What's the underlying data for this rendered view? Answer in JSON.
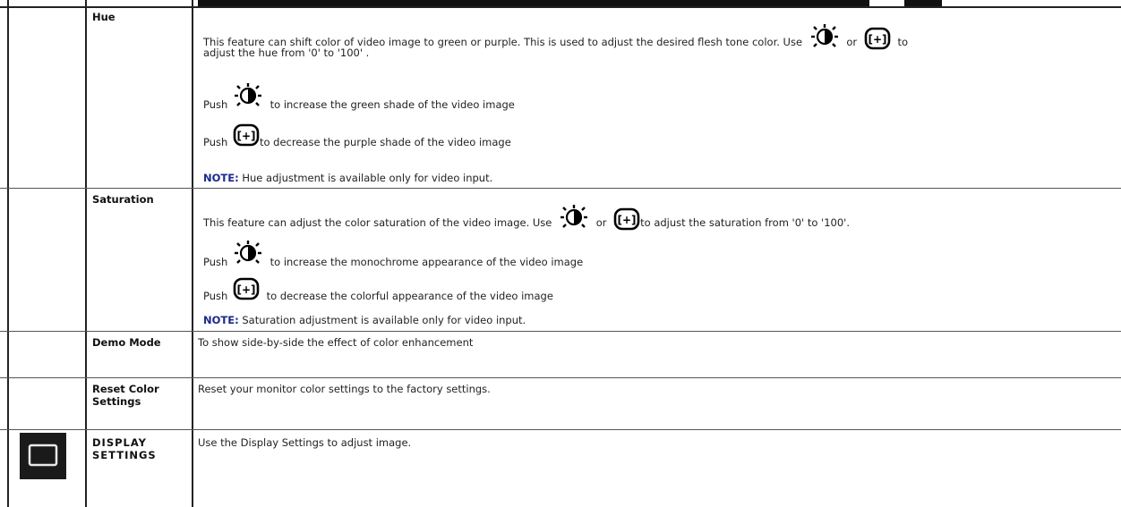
{
  "rows": {
    "hue": {
      "label": "Hue",
      "desc_a": "This feature can shift color of video image to green or purple. This is used to adjust the desired flesh tone color. Use",
      "desc_or": "or",
      "desc_to": "to",
      "desc_b": "adjust the hue from '0' to '100' .",
      "push": "Push",
      "increase": "to increase the green shade of the video image",
      "decrease": "to decrease the purple shade of the video image",
      "note_label": "NOTE:",
      "note_text": "Hue adjustment is available only for video input."
    },
    "saturation": {
      "label": "Saturation",
      "desc_a": "This feature can adjust the color saturation of the video image. Use",
      "desc_or": "or",
      "desc_b": "to adjust the saturation from '0' to '100'.",
      "push": "Push",
      "increase": "to increase the monochrome appearance of the video image",
      "decrease": "to decrease the colorful appearance of the video image",
      "note_label": "NOTE:",
      "note_text": "Saturation adjustment is available only for video input."
    },
    "demo": {
      "label": "Demo Mode",
      "text": "To show side-by-side the effect of color enhancement"
    },
    "reset": {
      "label_line1": "Reset Color",
      "label_line2": "Settings",
      "text": "Reset your monitor color settings to the factory settings."
    },
    "display": {
      "label_line1": "DISPLAY",
      "label_line2": "SETTINGS",
      "text": "Use the Display Settings to adjust image.",
      "icon": "display-monitor-icon"
    }
  },
  "icons": {
    "brightness": "brightness-sun-icon",
    "auto_adjust": "auto-adjust-icon"
  }
}
